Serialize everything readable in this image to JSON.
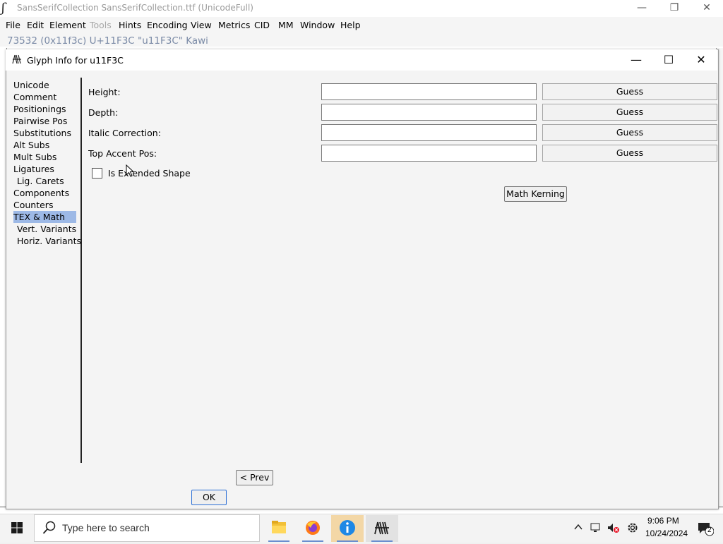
{
  "app": {
    "title": "SansSerifCollection  SansSerifCollection.ttf (UnicodeFull)",
    "glyph_info_line": "73532 (0x11f3c) U+11F3C \"u11F3C\" Kawi",
    "menu": [
      "File",
      "Edit",
      "Element",
      "Tools",
      "Hints",
      "Encoding",
      "View",
      "Metrics",
      "CID",
      "MM",
      "Window",
      "Help"
    ]
  },
  "dialog": {
    "title": "Glyph Info for u11F3C",
    "nav": [
      "Unicode",
      "Comment",
      "Positionings",
      "Pairwise Pos",
      "Substitutions",
      "Alt Subs",
      "Mult Subs",
      "Ligatures",
      "Lig. Carets",
      "Components",
      "Counters",
      "TEX & Math",
      "Vert. Variants",
      "Horiz. Variants"
    ],
    "selected_nav": "TEX & Math",
    "fields": [
      {
        "label": "Height:",
        "value": "",
        "button": "Guess"
      },
      {
        "label": "Depth:",
        "value": "",
        "button": "Guess"
      },
      {
        "label": "Italic Correction:",
        "value": "",
        "button": "Guess"
      },
      {
        "label": "Top Accent Pos:",
        "value": "",
        "button": "Guess"
      }
    ],
    "checkbox_label": "Is Extended Shape",
    "checkbox_checked": false,
    "math_kerning": "Math Kerning",
    "prev": "< Prev",
    "ok": "OK"
  },
  "taskbar": {
    "search_placeholder": "Type here to search",
    "time": "9:06 PM",
    "date": "10/24/2024",
    "notification_count": "2"
  }
}
